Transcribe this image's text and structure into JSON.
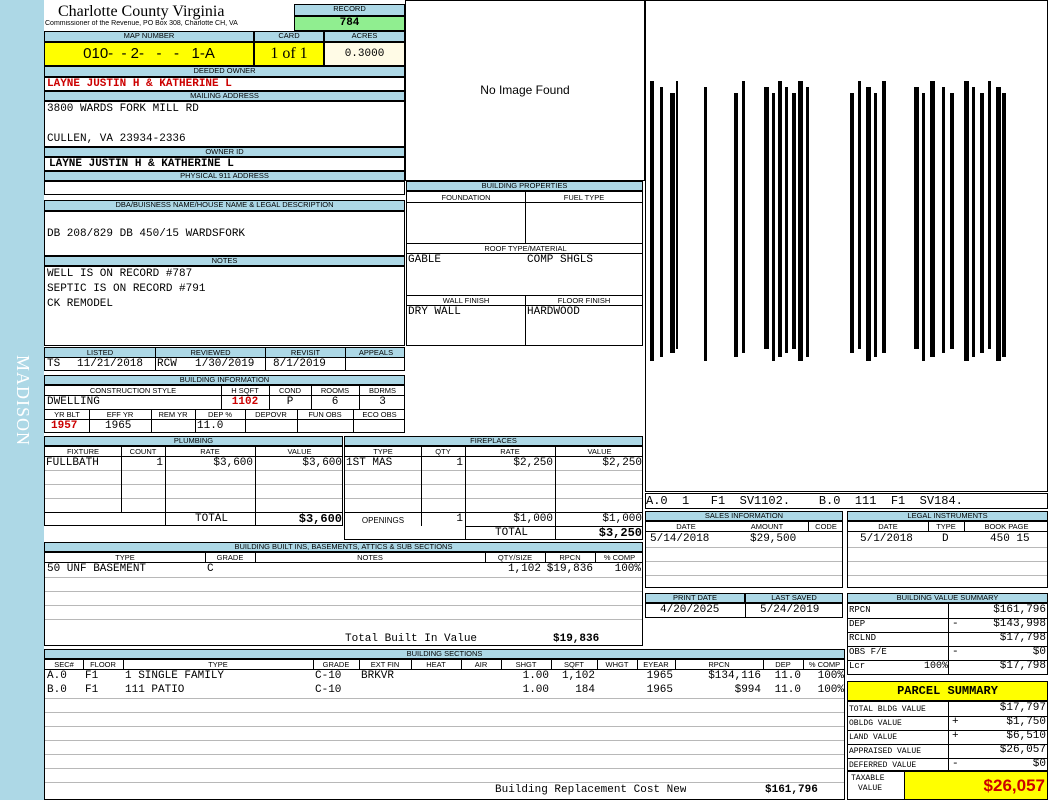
{
  "sidebar": {
    "district": "MADISON"
  },
  "header": {
    "county": "Charlotte County Virginia",
    "commissioner": "Commissioner of the Revenue, PO Box 308, Charlotte CH, VA",
    "record_label": "RECORD",
    "record": "784",
    "map_number_label": "MAP NUMBER",
    "map_number": "010-  - 2-   -   -   1-A",
    "card_label": "CARD",
    "card": "1 of 1",
    "acres_label": "ACRES",
    "acres": "0.3000"
  },
  "owner": {
    "deeded_owner_label": "DEEDED OWNER",
    "deeded_owner": "LAYNE JUSTIN H & KATHERINE L",
    "mailing_address_label": "MAILING ADDRESS",
    "address_line1": "3800 WARDS FORK MILL RD",
    "address_line2": "CULLEN, VA 23934-2336",
    "owner_id_label": "OWNER ID",
    "owner_id": "LAYNE JUSTIN H & KATHERINE L",
    "physical_address_label": "PHYSICAL 911 ADDRESS",
    "physical_address": ""
  },
  "photo": {
    "no_image": "No Image Found"
  },
  "legal": {
    "label": "DBA/BUISNESS NAME/HOUSE NAME & LEGAL DESCRIPTION",
    "text": "DB 208/829 DB 450/15 WARDSFORK"
  },
  "notes": {
    "label": "NOTES",
    "lines": [
      "WELL IS ON RECORD #787",
      "SEPTIC IS ON RECORD #791",
      "CK REMODEL"
    ]
  },
  "building_properties": {
    "label": "BUILDING PROPERTIES",
    "foundation_label": "FOUNDATION",
    "fuel_type_label": "FUEL TYPE",
    "roof_label": "ROOF TYPE/MATERIAL",
    "roof_type": "GABLE",
    "roof_material": "COMP SHGLS",
    "wall_finish_label": "WALL FINISH",
    "wall_finish": "DRY WALL",
    "floor_finish_label": "FLOOR FINISH",
    "floor_finish": "HARDWOOD"
  },
  "review": {
    "listed_label": "LISTED",
    "listed_by": "TS",
    "listed_date": "11/21/2018",
    "reviewed_label": "REVIEWED",
    "reviewed_by": "RCW",
    "reviewed_date": "1/30/2019",
    "revisit_label": "REVISIT",
    "revisit_date": "8/1/2019",
    "appeals_label": "APPEALS",
    "appeals": ""
  },
  "building_info": {
    "label": "BUILDING INFORMATION",
    "construction_style_label": "CONSTRUCTION STYLE",
    "hsqft_label": "H SQFT",
    "cond_label": "COND",
    "rooms_label": "ROOMS",
    "bdrms_label": "BDRMS",
    "construction_style": "DWELLING",
    "hsqft": "1102",
    "cond": "P",
    "rooms": "6",
    "bdrms": "3",
    "yr_blt_label": "YR BLT",
    "eff_yr_label": "EFF YR",
    "rem_yr_label": "REM YR",
    "dep_pct_label": "DEP %",
    "depovr_label": "DEPOVR",
    "fun_obs_label": "FUN OBS",
    "eco_obs_label": "ECO OBS",
    "yr_blt": "1957",
    "eff_yr": "1965",
    "rem_yr": "",
    "dep_pct": "11.0",
    "depovr": "",
    "fun_obs": "",
    "eco_obs": ""
  },
  "plumbing": {
    "label": "PLUMBING",
    "headers": [
      "FIXTURE",
      "COUNT",
      "RATE",
      "VALUE"
    ],
    "rows": [
      {
        "fixture": "FULLBATH",
        "count": "1",
        "rate": "$3,600",
        "value": "$3,600"
      }
    ],
    "total_label": "TOTAL",
    "total": "$3,600"
  },
  "fireplaces": {
    "label": "FIREPLACES",
    "headers": [
      "TYPE",
      "QTY",
      "RATE",
      "VALUE"
    ],
    "rows": [
      {
        "type": "1ST MAS",
        "qty": "1",
        "rate": "$2,250",
        "value": "$2,250"
      }
    ],
    "openings_label": "OPENINGS",
    "openings_qty": "1",
    "openings_rate": "$1,000",
    "openings_value": "$1,000",
    "total_label": "TOTAL",
    "total": "$3,250"
  },
  "barcode": {
    "text1": "A.0  1   F1  SV1102.",
    "text2": "B.0  111  F1  SV184."
  },
  "sales": {
    "label": "SALES INFORMATION",
    "headers": [
      "DATE",
      "AMOUNT",
      "CODE"
    ],
    "rows": [
      {
        "date": "5/14/2018",
        "amount": "$29,500",
        "code": ""
      }
    ]
  },
  "legal_instruments": {
    "label": "LEGAL INSTRUMENTS",
    "headers": [
      "DATE",
      "TYPE",
      "BOOK PAGE"
    ],
    "rows": [
      {
        "date": "5/1/2018",
        "type": "D",
        "book_page": "450 15"
      }
    ]
  },
  "built_ins": {
    "label": "BUILDING BUILT INS, BASEMENTS, ATTICS & SUB SECTIONS",
    "headers": [
      "TYPE",
      "GRADE",
      "NOTES",
      "QTY/SIZE",
      "RPCN",
      "% COMP"
    ],
    "rows": [
      {
        "type": "50 UNF BASEMENT",
        "grade": "C",
        "notes": "",
        "qty": "1,102",
        "rpcn": "$19,836",
        "comp": "100%"
      }
    ],
    "total_label": "Total Built In Value",
    "total": "$19,836"
  },
  "print_info": {
    "print_date_label": "PRINT DATE",
    "print_date": "4/20/2025",
    "last_saved_label": "LAST SAVED",
    "last_saved": "5/24/2019"
  },
  "value_summary": {
    "label": "BUILDING VALUE SUMMARY",
    "rows": [
      {
        "label": "RPCN",
        "sign": "",
        "pct": "",
        "value": "$161,796"
      },
      {
        "label": "DEP",
        "sign": "-",
        "pct": "",
        "value": "$143,998"
      },
      {
        "label": "RCLND",
        "sign": "",
        "pct": "",
        "value": "$17,798"
      },
      {
        "label": "OBS F/E",
        "sign": "-",
        "pct": "",
        "value": "$0"
      },
      {
        "label": "Lcr",
        "sign": "",
        "pct": "100%",
        "value": "$17,798"
      }
    ]
  },
  "building_sections": {
    "label": "BUILDING SECTIONS",
    "headers": [
      "SEC#",
      "FLOOR",
      "TYPE",
      "GRADE",
      "EXT FIN",
      "HEAT",
      "AIR",
      "SHGT",
      "SQFT",
      "WHGT",
      "EYEAR",
      "RPCN",
      "DEP",
      "% COMP"
    ],
    "rows": [
      {
        "sec": "A.0",
        "floor": "F1",
        "type": "1 SINGLE FAMILY",
        "grade": "C-10",
        "ext_fin": "BRKVR",
        "heat": "",
        "air": "",
        "shgt": "1.00",
        "sqft": "1,102",
        "whgt": "",
        "eyear": "1965",
        "rpcn": "$134,116",
        "dep": "11.0",
        "comp": "100%"
      },
      {
        "sec": "B.0",
        "floor": "F1",
        "type": "111 PATIO",
        "grade": "C-10",
        "ext_fin": "",
        "heat": "",
        "air": "",
        "shgt": "1.00",
        "sqft": "184",
        "whgt": "",
        "eyear": "1965",
        "rpcn": "$994",
        "dep": "11.0",
        "comp": "100%"
      }
    ],
    "replacement_label": "Building Replacement Cost New",
    "replacement_value": "$161,796"
  },
  "parcel_summary": {
    "label": "PARCEL SUMMARY",
    "rows": [
      {
        "label": "TOTAL BLDG VALUE",
        "sign": "",
        "value": "$17,797"
      },
      {
        "label": "OBLDG VALUE",
        "sign": "+",
        "value": "$1,750"
      },
      {
        "label": "LAND VALUE",
        "sign": "+",
        "value": "$6,510"
      },
      {
        "label": "APPRAISED VALUE",
        "sign": "",
        "value": "$26,057"
      },
      {
        "label": "DEFERRED VALUE",
        "sign": "-",
        "value": "$0"
      }
    ],
    "taxable_label_1": "TAXABLE",
    "taxable_label_2": "VALUE",
    "taxable_value": "$26,057"
  },
  "colors": {
    "header_blue": "#add8e6",
    "highlight_yellow": "#ffff00",
    "record_green": "#90ee90",
    "value_red": "#cc0000"
  }
}
